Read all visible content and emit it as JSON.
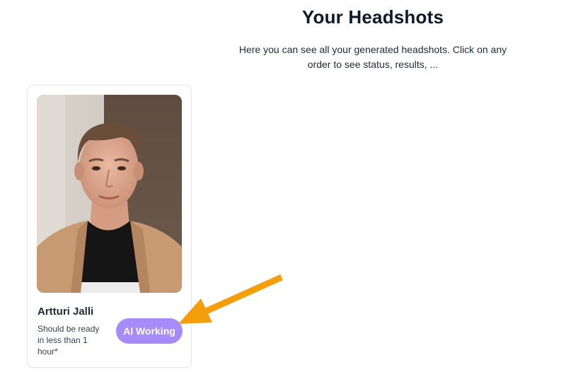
{
  "header": {
    "title": "Your Headshots",
    "subtitle": "Here you can see all your generated headshots. Click on any order to see status, results, ..."
  },
  "orders": [
    {
      "name": "Artturi Jalli",
      "eta": "Should be ready in less than 1 hour*",
      "status_label": "AI Working",
      "status_color": "#a78bfa"
    }
  ],
  "annotation": {
    "arrow_color": "#f59e0b",
    "icon": "arrow-icon"
  }
}
